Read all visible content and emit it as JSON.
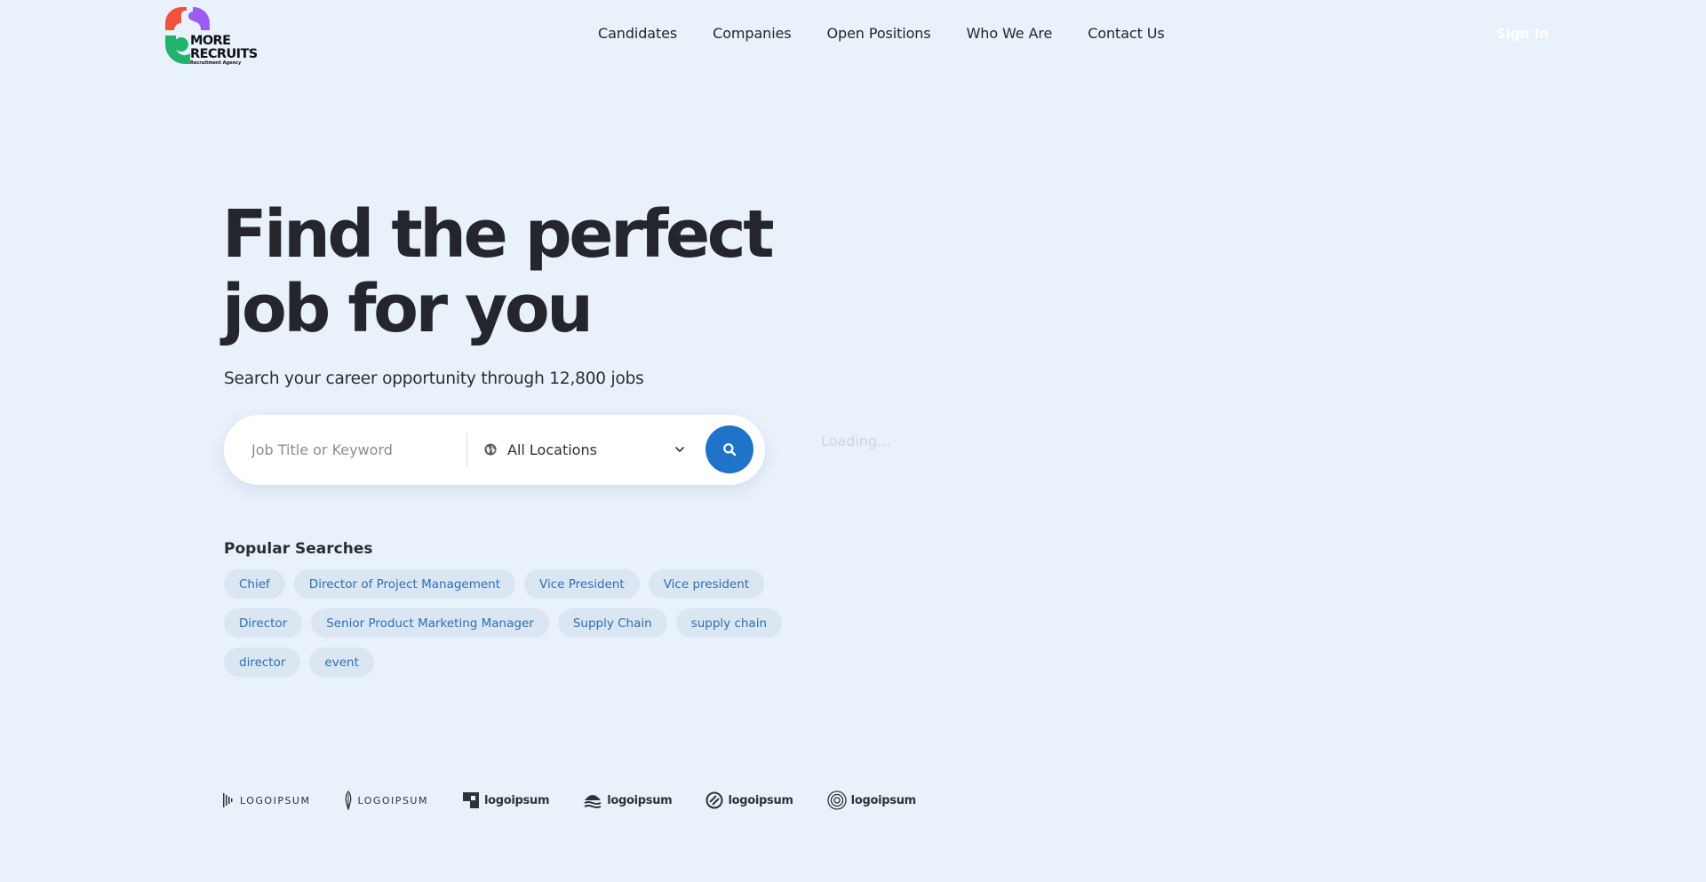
{
  "brand": {
    "name_line1": "MORE",
    "name_line2": "RECRUITS",
    "tagline": "Recruitment Agency",
    "colors": {
      "red": "#f0523f",
      "purple": "#9b5cf2",
      "green": "#21b36b"
    }
  },
  "nav": {
    "items": [
      {
        "label": "Candidates"
      },
      {
        "label": "Companies"
      },
      {
        "label": "Open Positions"
      },
      {
        "label": "Who We Are"
      },
      {
        "label": "Contact Us"
      }
    ],
    "signin_label": "Sign In"
  },
  "hero": {
    "headline_line1": "Find the perfect",
    "headline_line2": "job for you",
    "subtitle": "Search your career opportunity through 12,800 jobs"
  },
  "search": {
    "keyword_placeholder": "Job Title or Keyword",
    "location_value": "All Locations",
    "button_icon": "search-icon",
    "accent_color": "#1f73c9"
  },
  "loading_text": "Loading...",
  "popular": {
    "title": "Popular Searches",
    "rows": [
      [
        "Chief",
        "Director of Project Management",
        "Vice President",
        "Vice president"
      ],
      [
        "Director",
        "Senior Product Marketing Manager",
        "Supply Chain",
        "supply chain"
      ],
      [
        "director",
        "event"
      ]
    ]
  },
  "clients": {
    "logos": [
      {
        "icon": "soundwave-icon",
        "text": "LOGOIPSUM"
      },
      {
        "icon": "feather-icon",
        "text": "LOGOIPSUM"
      },
      {
        "icon": "square-bracket-icon",
        "text": "logoipsum"
      },
      {
        "icon": "layers-icon",
        "text": "logoipsum"
      },
      {
        "icon": "slashed-circle-icon",
        "text": "logoipsum"
      },
      {
        "icon": "concentric-circle-icon",
        "text": "logoipsum"
      }
    ]
  }
}
